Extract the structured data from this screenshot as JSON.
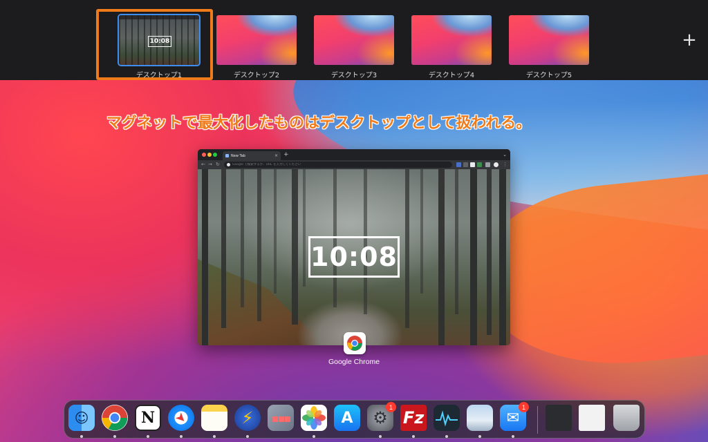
{
  "spaces": {
    "items": [
      {
        "label": "デスクトップ1",
        "active": true,
        "clock": "10:08"
      },
      {
        "label": "デスクトップ2",
        "active": false
      },
      {
        "label": "デスクトップ3",
        "active": false
      },
      {
        "label": "デスクトップ4",
        "active": false
      },
      {
        "label": "デスクトップ5",
        "active": false
      }
    ],
    "add_label": "+"
  },
  "caption": "マグネットで最大化したものはデスクトップとして扱われる。",
  "window": {
    "tab_label": "New Tab",
    "tab_close": "×",
    "new_tab": "+",
    "omnibox_placeholder": "Google で検索するか、URL を入力してください",
    "clock": "10:08"
  },
  "app": {
    "name": "Google Chrome"
  },
  "dock": {
    "items": [
      {
        "name": "finder",
        "running": true
      },
      {
        "name": "google-chrome",
        "running": true
      },
      {
        "name": "notion",
        "running": true
      },
      {
        "name": "safari",
        "running": true
      },
      {
        "name": "notes",
        "running": true
      },
      {
        "name": "reeder",
        "running": true
      },
      {
        "name": "launchpad",
        "running": false
      },
      {
        "name": "photos",
        "running": true
      },
      {
        "name": "app-store",
        "running": false
      },
      {
        "name": "system-preferences",
        "running": true,
        "badge": "1"
      },
      {
        "name": "filezilla",
        "running": true
      },
      {
        "name": "activity-monitor",
        "running": true
      },
      {
        "name": "preview",
        "running": true
      },
      {
        "name": "mail",
        "running": true,
        "badge": "1"
      }
    ],
    "recent": [
      {
        "name": "recent-window-1"
      },
      {
        "name": "recent-window-2"
      }
    ],
    "trash": {
      "name": "trash"
    }
  },
  "colors": {
    "highlight": "#f07b1a",
    "active_outline": "#3d8ef0",
    "badge": "#ff3b30"
  }
}
